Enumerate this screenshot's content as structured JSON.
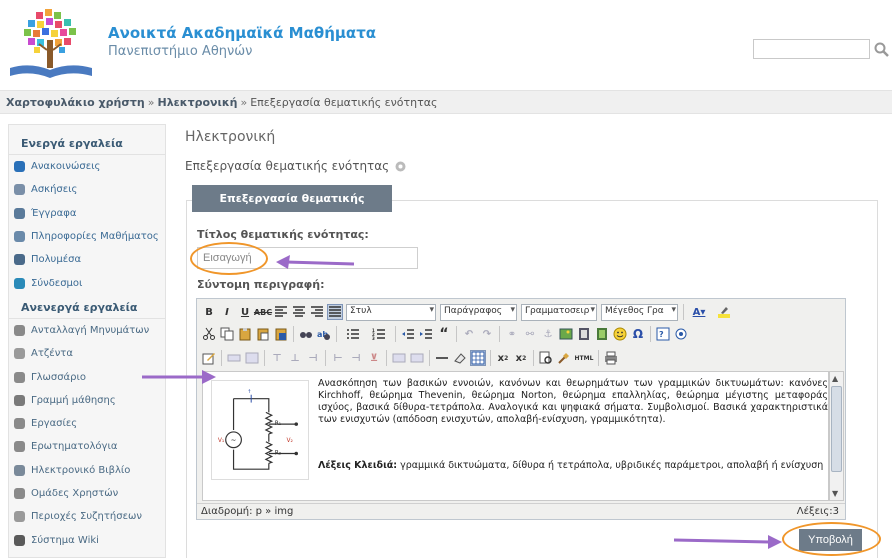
{
  "header": {
    "site_title": "Ανοικτά Ακαδημαϊκά Μαθήματα",
    "site_subtitle": "Πανεπιστήμιο Αθηνών",
    "search_placeholder": ""
  },
  "breadcrumb": {
    "items": [
      "Χαρτοφυλάκιο χρήστη",
      "Ηλεκτρονική",
      "Επεξεργασία θεματικής ενότητας"
    ]
  },
  "sidebar": {
    "active_title": "Ενεργά εργαλεία",
    "active_items": [
      "Ανακοινώσεις",
      "Ασκήσεις",
      "Έγγραφα",
      "Πληροφορίες Μαθήματος",
      "Πολυμέσα",
      "Σύνδεσμοι"
    ],
    "inactive_title": "Ανενεργά εργαλεία",
    "inactive_items": [
      "Ανταλλαγή Μηνυμάτων",
      "Ατζέντα",
      "Γλωσσάριο",
      "Γραμμή μάθησης",
      "Εργασίες",
      "Ερωτηματολόγια",
      "Ηλεκτρονικό Βιβλίο",
      "Ομάδες Χρηστών",
      "Περιοχές Συζητήσεων",
      "Σύστημα Wiki"
    ]
  },
  "main": {
    "course_title": "Ηλεκτρονική",
    "page_subtitle": "Επεξεργασία θεματικής ενότητας",
    "panel_tab": "Επεξεργασία θεματικής ενότητας",
    "title_label": "Τίτλος θεματικής ενότητας:",
    "title_value": "Εισαγωγή",
    "desc_label": "Σύντομη περιγραφή:",
    "submit_label": "Υποβολή"
  },
  "editor": {
    "style_select": "Στυλ",
    "format_select": "Παράγραφος",
    "font_select": "Γραμματοσειρ",
    "size_select": "Μέγεθος Γρα",
    "content_paragraph": "Ανασκόπηση των βασικών εννοιών, κανόνων και θεωρημάτων των γραμμικών δικτυωμάτων: κανόνες Kirchhoff, θεώρημα Thevenin, θεώρημα Norton, θεώρημα επαλληλίας, θεώρημα μέγιστης μεταφοράς ισχύος, βασικά δίθυρα-τετράπολα. Αναλογικά και ψηφιακά σήματα. Συμβολισμοί. Βασικά χαρακτηριστικά των ενισχυτών (απόδοση ενισχυτών, απολαβή-ενίσχυση, γραμμικότητα).",
    "keywords_label": "Λέξεις Κλειδιά:",
    "keywords_text": "γραμμικά δικτυώματα, δίθυρα ή τετράπολα, υβριδικές παράμετροι, απολαβή ή ενίσχυση",
    "path_label": "Διαδρομή: p » img",
    "word_count": "Λέξεις:3",
    "circuit_labels": [
      "R₁",
      "R₂",
      "V₁",
      "V₂"
    ]
  },
  "colors": {
    "accent": "#2a8fd2",
    "tab_bg": "#6d7b89",
    "highlight_ring": "#f0962a",
    "arrow": "#9b6ac8"
  }
}
